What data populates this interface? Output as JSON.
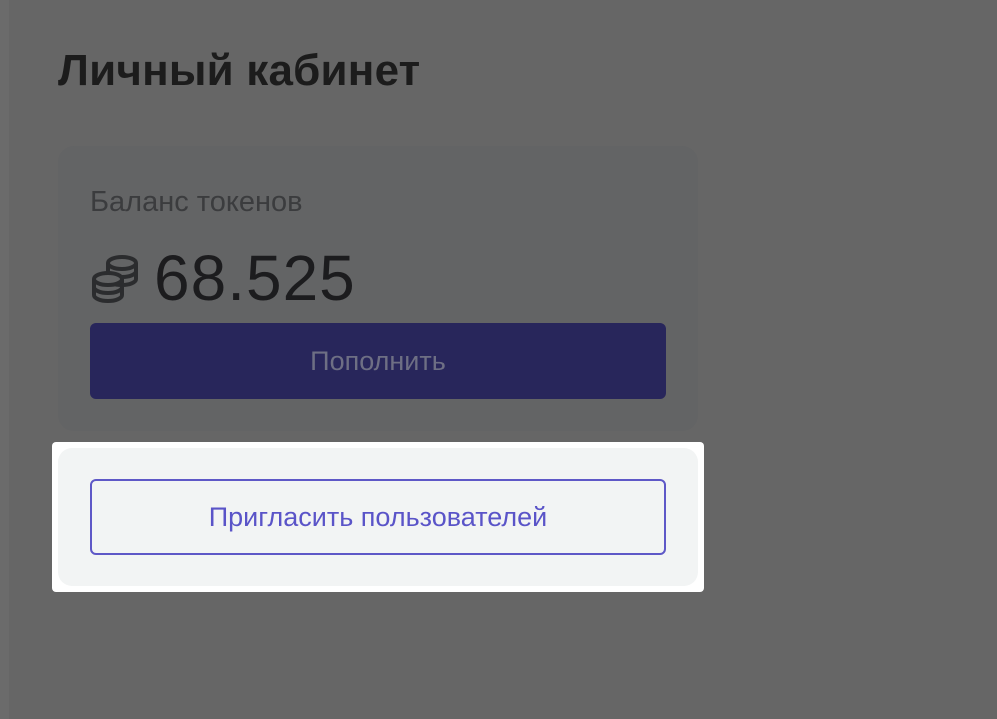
{
  "page": {
    "title": "Личный кабинет"
  },
  "balance": {
    "label": "Баланс токенов",
    "value": "68.525",
    "icon": "coins-icon",
    "topup_label": "Пополнить"
  },
  "invite": {
    "button_label": "Пригласить пользователей"
  },
  "colors": {
    "overlay": "#666666",
    "primary": "#28265b",
    "accent": "#5e58c7",
    "highlight": "#ffffff"
  }
}
